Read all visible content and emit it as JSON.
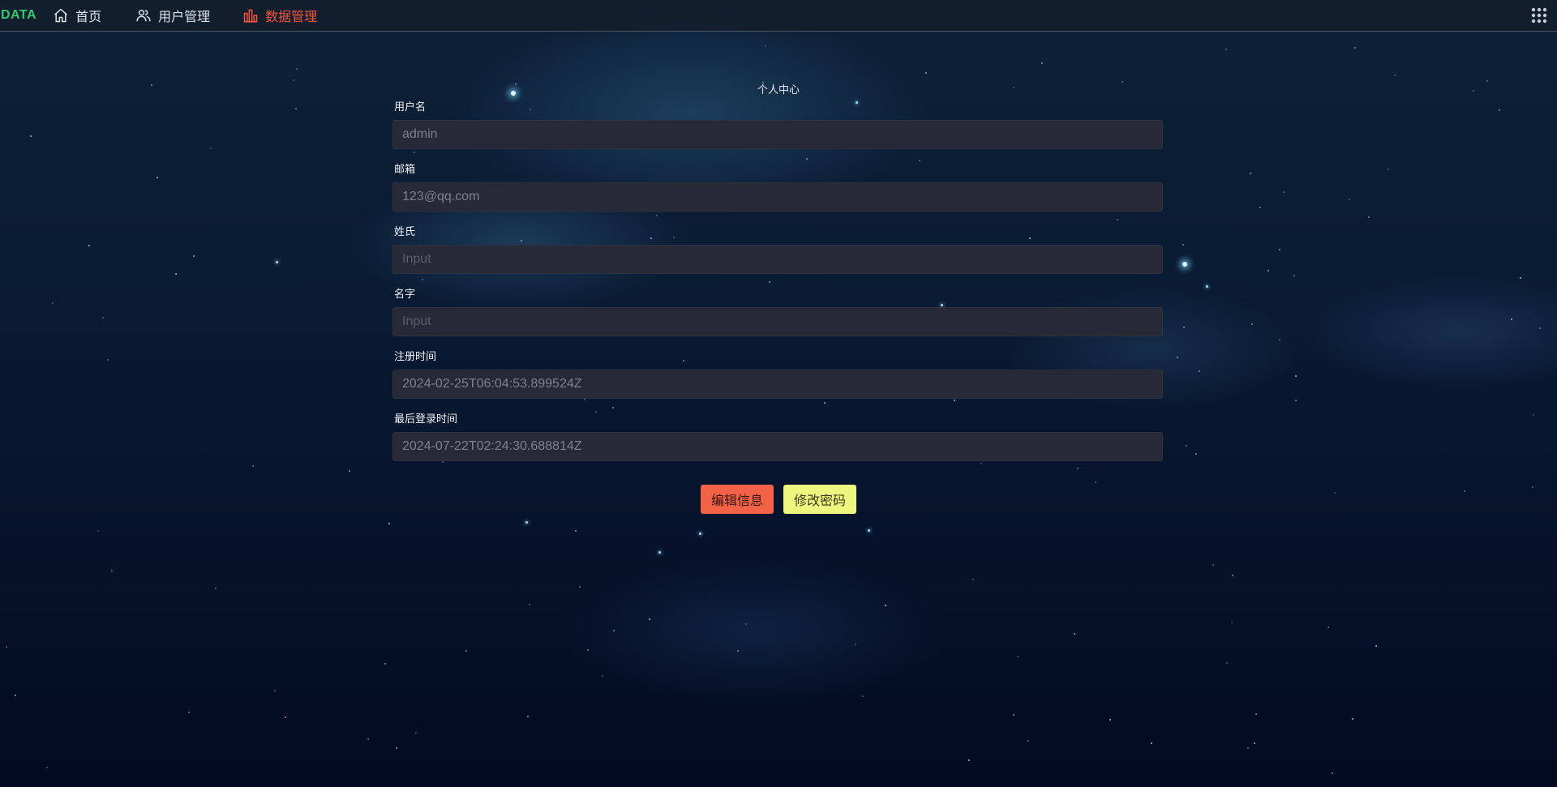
{
  "nav": {
    "brand": "DATA",
    "items": [
      {
        "label": "首页",
        "icon": "home-icon"
      },
      {
        "label": "用户管理",
        "icon": "users-icon"
      },
      {
        "label": "数据管理",
        "icon": "bar-chart-icon"
      }
    ],
    "active_color": "#f2553c",
    "brand_color": "#2ecc71"
  },
  "page": {
    "title": "个人中心"
  },
  "form": {
    "username": {
      "label": "用户名",
      "value": "admin"
    },
    "email": {
      "label": "邮箱",
      "value": "123@qq.com"
    },
    "last_name": {
      "label": "姓氏",
      "placeholder": "Input"
    },
    "first_name": {
      "label": "名字",
      "placeholder": "Input"
    },
    "date_joined": {
      "label": "注册时间",
      "value": "2024-02-25T06:04:53.899524Z"
    },
    "last_login": {
      "label": "最后登录时间",
      "value": "2024-07-22T02:24:30.688814Z"
    }
  },
  "actions": {
    "edit_label": "编辑信息",
    "change_password_label": "修改密码",
    "edit_color": "#f26247",
    "change_password_color": "#eef77d"
  }
}
